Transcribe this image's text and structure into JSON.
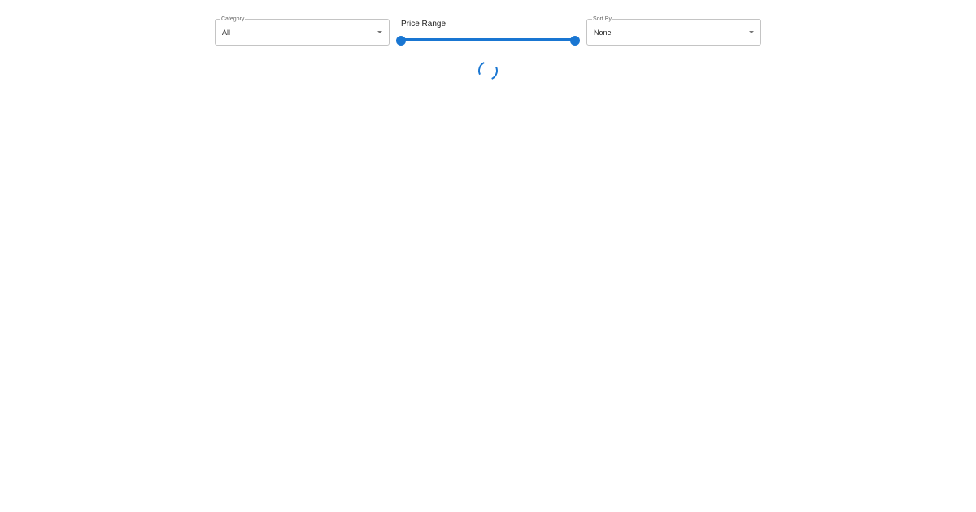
{
  "filters": {
    "category": {
      "label": "Category",
      "value": "All"
    },
    "price_range": {
      "label": "Price Range",
      "min_fraction": 0,
      "max_fraction": 1
    },
    "sort_by": {
      "label": "Sort By",
      "value": "None"
    }
  },
  "colors": {
    "accent": "#1976d2"
  },
  "loading": {
    "icon": "spinner-icon"
  }
}
